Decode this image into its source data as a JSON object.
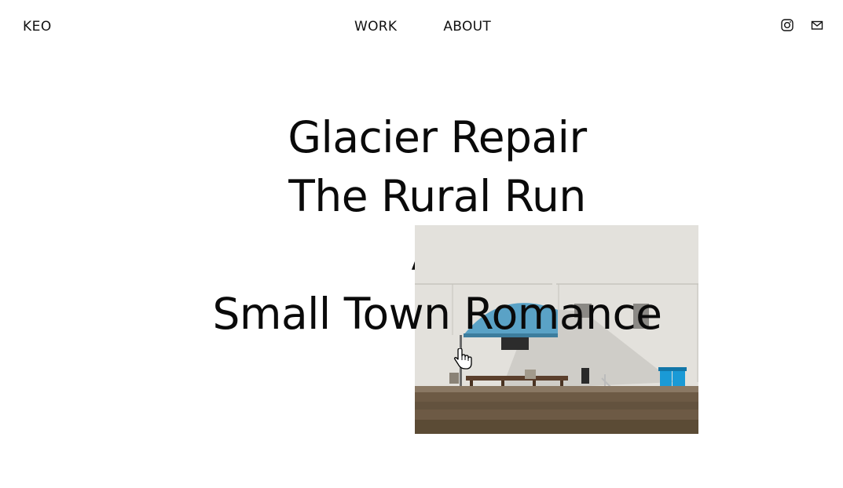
{
  "header": {
    "logo": "KEO",
    "nav": [
      {
        "label": "WORK"
      },
      {
        "label": "ABOUT"
      }
    ],
    "social": [
      {
        "icon": "instagram-icon"
      },
      {
        "icon": "mail-icon"
      }
    ]
  },
  "projects": [
    {
      "title": "Glacier Repair"
    },
    {
      "title": "The Rural Run"
    },
    {
      "title": "Ac"
    },
    {
      "title": "Small Town Romance"
    }
  ],
  "preview": {
    "description_colors": {
      "wall": "#e3e1dc",
      "awning": "#5aa2c6",
      "ground": "#6d5a45",
      "bins": "#1a9ad6"
    }
  },
  "colors": {
    "text": "#0a0a0a",
    "background": "#ffffff"
  }
}
